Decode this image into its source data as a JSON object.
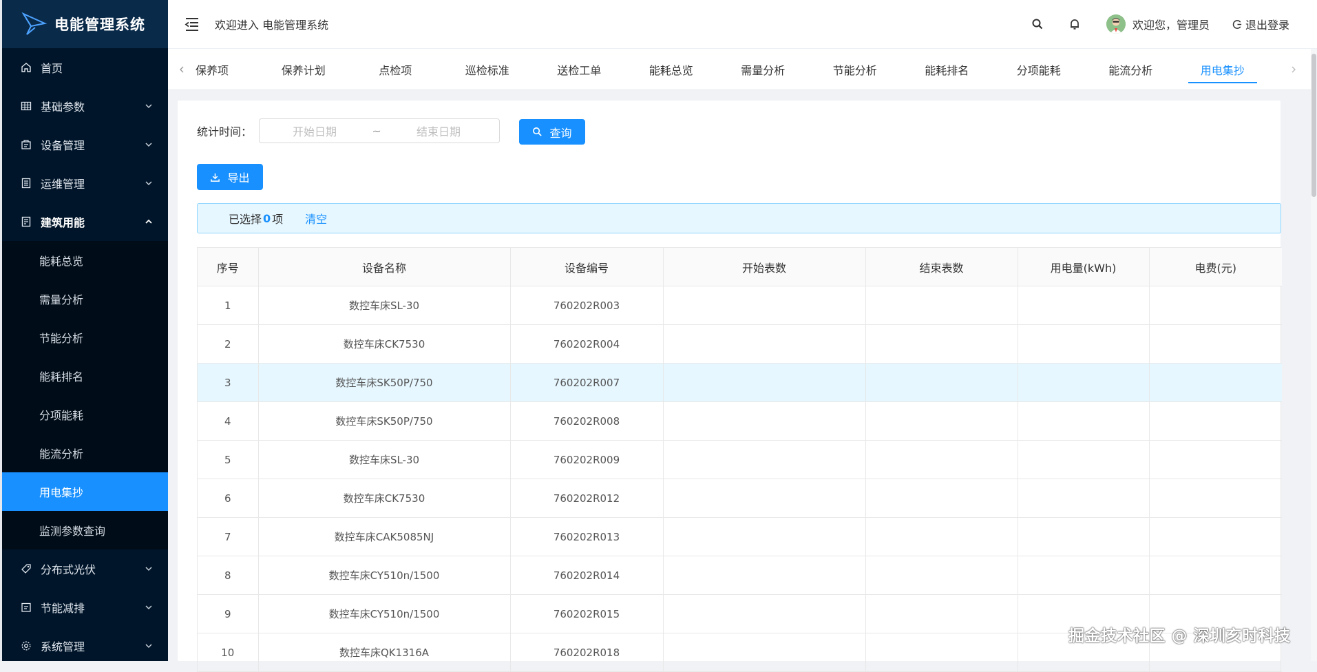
{
  "app": {
    "title": "电能管理系统"
  },
  "sidebar": {
    "items": [
      {
        "label": "首页"
      },
      {
        "label": "基础参数"
      },
      {
        "label": "设备管理"
      },
      {
        "label": "运维管理"
      },
      {
        "label": "建筑用能"
      },
      {
        "label": "分布式光伏"
      },
      {
        "label": "节能减排"
      },
      {
        "label": "系统管理"
      }
    ],
    "submenu": [
      {
        "label": "能耗总览"
      },
      {
        "label": "需量分析"
      },
      {
        "label": "节能分析"
      },
      {
        "label": "能耗排名"
      },
      {
        "label": "分项能耗"
      },
      {
        "label": "能流分析"
      },
      {
        "label": "用电集抄"
      },
      {
        "label": "监测参数查询"
      }
    ]
  },
  "header": {
    "welcome": "欢迎进入 电能管理系统",
    "user_greeting": "欢迎您，管理员",
    "logout": "退出登录"
  },
  "tabs": [
    {
      "label": "保养项"
    },
    {
      "label": "保养计划"
    },
    {
      "label": "点检项"
    },
    {
      "label": "巡检标准"
    },
    {
      "label": "送检工单"
    },
    {
      "label": "能耗总览"
    },
    {
      "label": "需量分析"
    },
    {
      "label": "节能分析"
    },
    {
      "label": "能耗排名"
    },
    {
      "label": "分项能耗"
    },
    {
      "label": "能流分析"
    },
    {
      "label": "用电集抄"
    }
  ],
  "filter": {
    "label": "统计时间：",
    "start_placeholder": "开始日期",
    "separator": "~",
    "end_placeholder": "结束日期",
    "query_button": "查询",
    "export_button": "导出"
  },
  "selection": {
    "prefix": "已选择",
    "count": "0",
    "suffix": "项",
    "clear": "清空"
  },
  "table": {
    "columns": [
      "序号",
      "设备名称",
      "设备编号",
      "开始表数",
      "结束表数",
      "用电量(kWh)",
      "电费(元)"
    ],
    "rows": [
      {
        "no": "1",
        "name": "数控车床SL-30",
        "code": "760202R003",
        "start": "",
        "end": "",
        "kwh": "",
        "fee": ""
      },
      {
        "no": "2",
        "name": "数控车床CK7530",
        "code": "760202R004",
        "start": "",
        "end": "",
        "kwh": "",
        "fee": ""
      },
      {
        "no": "3",
        "name": "数控车床SK50P/750",
        "code": "760202R007",
        "start": "",
        "end": "",
        "kwh": "",
        "fee": ""
      },
      {
        "no": "4",
        "name": "数控车床SK50P/750",
        "code": "760202R008",
        "start": "",
        "end": "",
        "kwh": "",
        "fee": ""
      },
      {
        "no": "5",
        "name": "数控车床SL-30",
        "code": "760202R009",
        "start": "",
        "end": "",
        "kwh": "",
        "fee": ""
      },
      {
        "no": "6",
        "name": "数控车床CK7530",
        "code": "760202R012",
        "start": "",
        "end": "",
        "kwh": "",
        "fee": ""
      },
      {
        "no": "7",
        "name": "数控车床CAK5085NJ",
        "code": "760202R013",
        "start": "",
        "end": "",
        "kwh": "",
        "fee": ""
      },
      {
        "no": "8",
        "name": "数控车床CY510n/1500",
        "code": "760202R014",
        "start": "",
        "end": "",
        "kwh": "",
        "fee": ""
      },
      {
        "no": "9",
        "name": "数控车床CY510n/1500",
        "code": "760202R015",
        "start": "",
        "end": "",
        "kwh": "",
        "fee": ""
      },
      {
        "no": "10",
        "name": "数控车床QK1316A",
        "code": "760202R018",
        "start": "",
        "end": "",
        "kwh": "",
        "fee": ""
      }
    ]
  },
  "watermark": "掘金技术社区 @ 深圳亥时科技",
  "colors": {
    "primary": "#1890ff",
    "sidebar_bg": "#001529",
    "highlight_row": "#e6f7ff"
  },
  "icons": {
    "sidebar": [
      "home-icon",
      "table-grid-icon",
      "device-icon",
      "list-icon",
      "building-icon",
      "tag-icon",
      "calendar-icon",
      "gear-icon"
    ],
    "header": [
      "menu-fold-icon",
      "search-icon",
      "bell-icon",
      "avatar",
      "logout-icon"
    ]
  }
}
